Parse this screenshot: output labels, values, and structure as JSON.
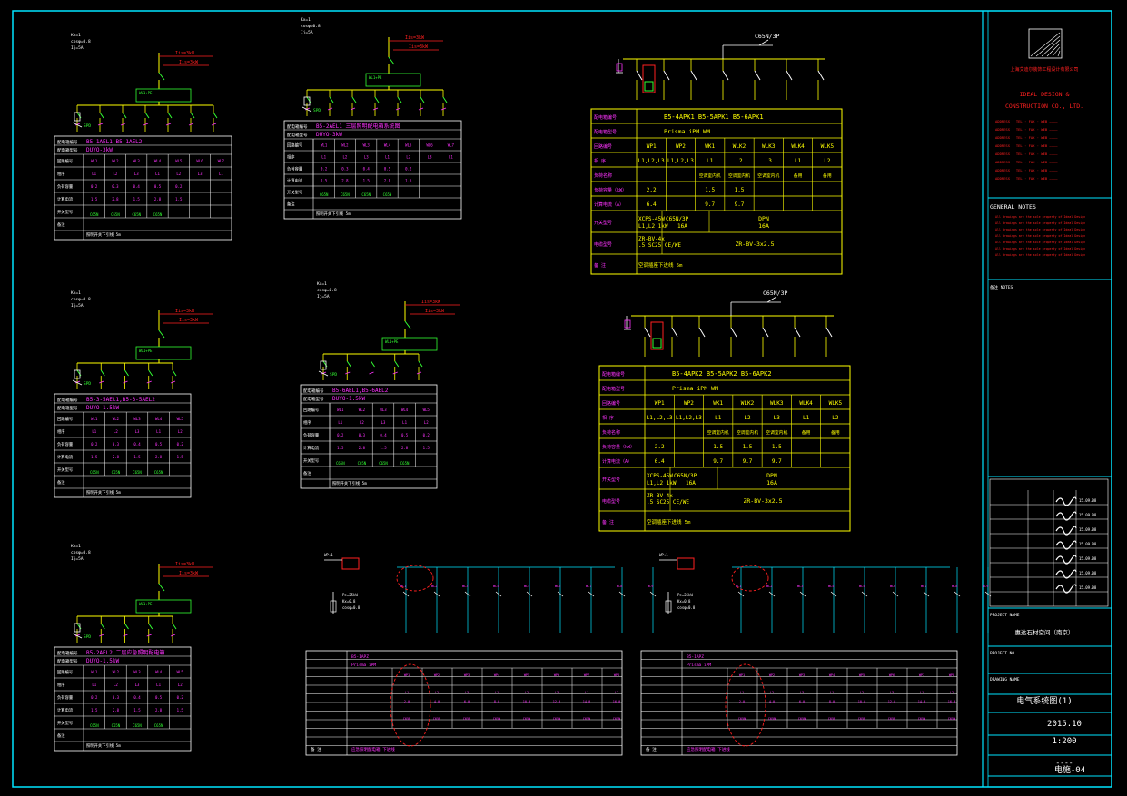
{
  "colors": {
    "bg": "#000000",
    "border": "#00e5ff",
    "table": "#ffff00",
    "magenta": "#ff33ff",
    "green": "#33ff33",
    "red": "#ff2020",
    "cyan": "#00e5ff",
    "white": "#ffffff"
  },
  "title_block": {
    "company_cn": "上海艾迪尔装饰工程设计有限公司",
    "company_en1": "IDEAL DESIGN &",
    "company_en2": "CONSTRUCTION CO., LTD.",
    "general_notes": "GENERAL NOTES",
    "project_name_label": "PROJECT NAME",
    "project_name": "惠达石材空间（南京）",
    "project_no_label": "PROJECT NO.",
    "drawing_name_label": "DRAWING NAME",
    "drawing_name": "电气系统图(1)",
    "date": "2015.10",
    "scale": "1:200",
    "blank": "----",
    "sheet": "电施-04"
  },
  "panel_small": {
    "incoming": "Iis=3kW",
    "params": [
      "Kx=1",
      "cosφ=0.8",
      "Ij=5A"
    ],
    "rows": [
      "回路编号",
      "相序",
      "负荷容量",
      "计算电流",
      "开关型号",
      "备注"
    ],
    "circuits": [
      "WL1",
      "WL2",
      "WL3",
      "WL4",
      "WL5",
      "WL6",
      "WL7"
    ]
  },
  "panel_titles": {
    "p1": "B5-1AEL1,B5-1AEL2",
    "p1b": "DUYO-3kW",
    "p2": "B5-2AEL1 三层照明配电箱系统图",
    "p2b": "DUYO-3kW",
    "p3": "B5-3-5AEL1,B5-3-5AEL2",
    "p3b": "DUYO-1.5kW",
    "p4": "B5-6AEL1,B5-6AEL2",
    "p4b": "DUYO-1.5kW",
    "p5": "B5-2AEL2 二层应急照明配电箱",
    "p5b": "DUYO-1.5kW",
    "p6": "B5-4APK1",
    "p7": "B5-4APK2"
  },
  "big_panel_1": {
    "breaker": "C65N/3P",
    "header_label": "配电箱编号",
    "header_value": "B5-4APK1 B5-5APK1 B5-6APK1",
    "type_label": "配电箱型号",
    "type_value": "Prisma iPM WM",
    "circuit_label": "回路编号",
    "circuits": [
      "WP1",
      "WP2",
      "WK1",
      "WLK2",
      "WLK3",
      "WLK4",
      "WLK5"
    ],
    "phase_label": "相 序",
    "phases": [
      "L1,L2,L3",
      "L1,L2,L3",
      "L1",
      "L2",
      "L3",
      "L1",
      "L2"
    ],
    "use_label": "负荷名称",
    "uses": [
      "",
      "",
      "空调室内机",
      "空调室内机",
      "空调室内机",
      "备用",
      "备用"
    ],
    "power_label": "负荷容量（kW）",
    "powers": [
      "2.2",
      "",
      "1.5",
      "1.5",
      "",
      "",
      ""
    ],
    "current_label": "计算电流（A）",
    "currents": [
      "6.4",
      "",
      "9.7",
      "9.7",
      "",
      "",
      ""
    ],
    "switch_label": "开关型号",
    "switch_a": "XCPS-45W",
    "switch_a2": "L1,L2 1kW",
    "switch_b": "C65N/3P",
    "switch_b2": "16A",
    "switch_c": "DPN",
    "switch_c2": "16A",
    "cable_label": "电缆型号",
    "cable_a": "ZR-BV-4x2.5 SC25 CE/WE",
    "cable_b": "ZR-BV-3x2.5",
    "note_label": "备 注",
    "note": "空调插座下进线 5m"
  },
  "big_panel_2": {
    "breaker": "C65N/3P",
    "header_value": "B5-4APK2 B5-5APK2 B5-6APK2",
    "type_value": "Prisma iPM WM",
    "circuits": [
      "WP1",
      "WP2",
      "WK1",
      "WLK2",
      "WLK3",
      "WLK4",
      "WLK5"
    ],
    "phases": [
      "L1,L2,L3",
      "L1,L2,L3",
      "L1",
      "L2",
      "L3",
      "L1",
      "L2"
    ],
    "uses": [
      "",
      "",
      "空调室内机",
      "空调室内机",
      "空调室内机",
      "备用",
      "备用"
    ],
    "powers": [
      "2.2",
      "",
      "1.5",
      "1.5",
      "1.5",
      "",
      ""
    ],
    "currents": [
      "6.4",
      "",
      "9.7",
      "9.7",
      "9.7",
      "",
      ""
    ],
    "switch_a": "XCPS-45W",
    "switch_a2": "L1,L2 1kW",
    "switch_b": "C65N/3P",
    "switch_b2": "16A",
    "switch_c": "DPN",
    "switch_c2": "16A",
    "cable_a": "ZR-BV-4x2.5 SC25 CE/WE",
    "cable_b": "ZR-BV-3x2.5",
    "note": "空调插座下进线 5m"
  }
}
